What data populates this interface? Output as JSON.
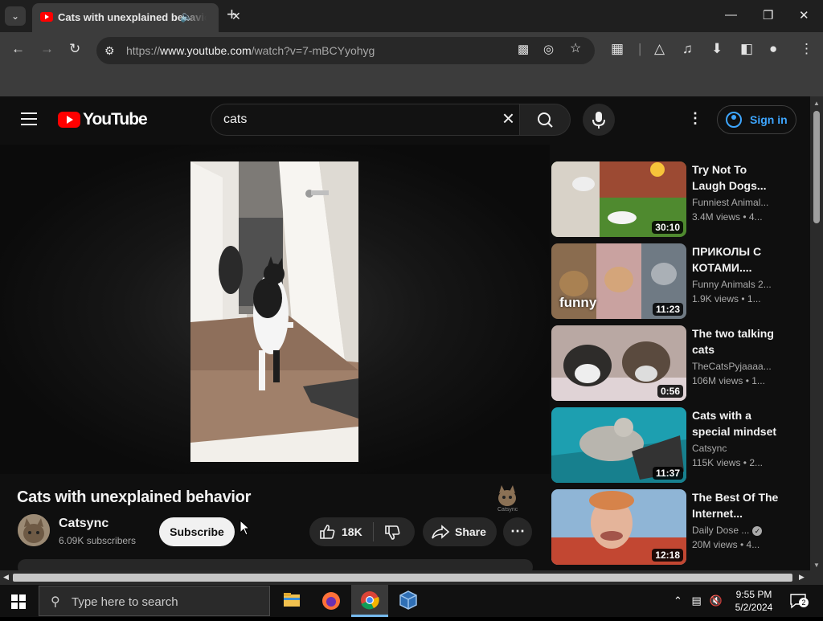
{
  "browser": {
    "tab_title": "Cats with unexplained behavior",
    "url_prefix": "https://",
    "url_host": "www.youtube.com",
    "url_path": "/watch?v=7-mBCYyohyg"
  },
  "youtube": {
    "logo_text": "YouTube",
    "search_query": "cats",
    "sign_in_label": "Sign in",
    "video": {
      "title": "Cats with unexplained behavior",
      "channel_name": "Catsync",
      "subscribers": "6.09K subscribers",
      "subscribe_label": "Subscribe",
      "likes": "18K",
      "share_label": "Share",
      "watermark_text": "Catsync"
    },
    "recommendations": [
      {
        "title": "Try Not To Laugh Dogs...",
        "channel": "Funniest Animal...",
        "meta": "3.4M views • 4...",
        "duration": "30:10"
      },
      {
        "title": "ПРИКОЛЫ С КОТАМИ....",
        "channel": "Funny Animals 2...",
        "meta": "1.9K views • 1...",
        "duration": "11:23",
        "thumb_text": "funny"
      },
      {
        "title": "The two talking cats",
        "channel": "TheCatsPyjaaaa...",
        "meta": "106M views • 1...",
        "duration": "0:56"
      },
      {
        "title": "Cats with a special mindset",
        "channel": "Catsync",
        "meta": "115K views • 2...",
        "duration": "11:37"
      },
      {
        "title": "The Best Of The Internet...",
        "channel": "Daily Dose ...",
        "meta": "20M views • 4...",
        "duration": "12:18"
      }
    ]
  },
  "taskbar": {
    "search_placeholder": "Type here to search",
    "time": "9:55 PM",
    "date": "5/2/2024",
    "notifications": "2"
  },
  "icons": {
    "tab_search": "chevron-down-icon",
    "audio": "speaker-icon",
    "back": "arrow-left-icon",
    "reload": "reload-icon",
    "menu": "hamburger-icon",
    "search": "search-icon",
    "mic": "mic-icon"
  }
}
